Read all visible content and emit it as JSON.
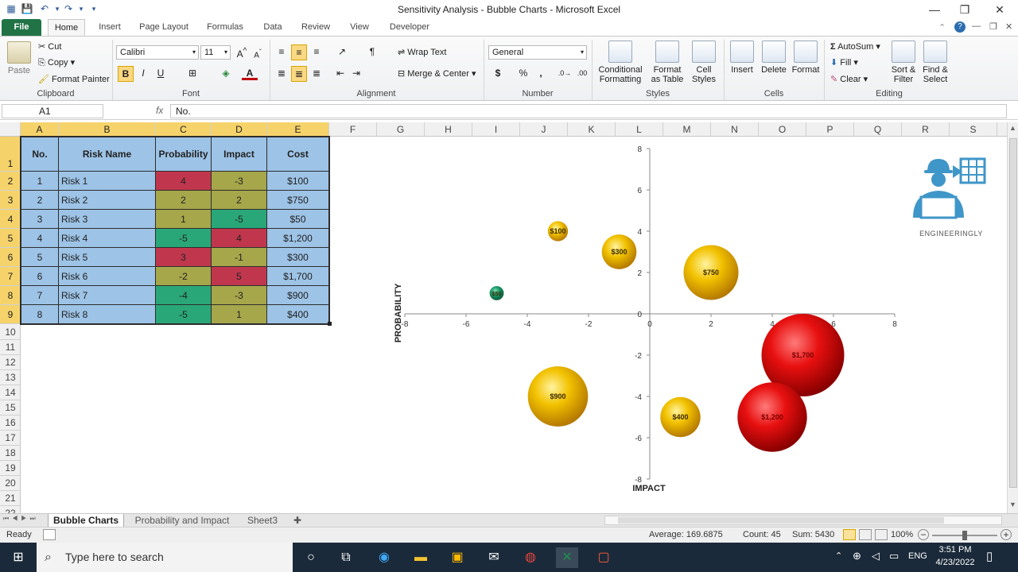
{
  "window": {
    "title": "Sensitivity Analysis - Bubble Charts - Microsoft Excel"
  },
  "ribbon_tabs": [
    "File",
    "Home",
    "Insert",
    "Page Layout",
    "Formulas",
    "Data",
    "Review",
    "View",
    "Developer"
  ],
  "clipboard": {
    "paste": "Paste",
    "cut": "Cut",
    "copy": "Copy",
    "format_painter": "Format Painter",
    "label": "Clipboard"
  },
  "font": {
    "name": "Calibri",
    "size": "11",
    "label": "Font",
    "bold": "B",
    "italic": "I",
    "underline": "U"
  },
  "alignment": {
    "wrap_text": "Wrap Text",
    "merge_center": "Merge & Center",
    "label": "Alignment"
  },
  "number": {
    "format": "General",
    "label": "Number",
    "currency": "$",
    "percent": "%",
    "comma": ","
  },
  "styles": {
    "conditional": "Conditional",
    "formatting": "Formatting",
    "format_as": "Format",
    "as_table": "as Table",
    "cell": "Cell",
    "cell_styles": "Styles",
    "label": "Styles"
  },
  "cells": {
    "insert": "Insert",
    "delete": "Delete",
    "format": "Format",
    "label": "Cells"
  },
  "editing": {
    "autosum": "AutoSum",
    "fill": "Fill",
    "clear": "Clear",
    "sort": "Sort &",
    "filter": "Filter",
    "find": "Find &",
    "select": "Select",
    "label": "Editing"
  },
  "formula_bar": {
    "name_box": "A1",
    "fx": "fx",
    "value": "No."
  },
  "columns": [
    "A",
    "B",
    "C",
    "D",
    "E",
    "F",
    "G",
    "H",
    "I",
    "J",
    "K",
    "L",
    "M",
    "N",
    "O",
    "P",
    "Q",
    "R",
    "S"
  ],
  "rows": [
    "1",
    "2",
    "3",
    "4",
    "5",
    "6",
    "7",
    "8",
    "9",
    "10",
    "11",
    "12",
    "13",
    "14",
    "15",
    "16",
    "17",
    "18",
    "19",
    "20",
    "21",
    "22"
  ],
  "table": {
    "headers": [
      "No.",
      "Risk Name",
      "Probability",
      "Impact",
      "Cost"
    ],
    "rows": [
      {
        "no": "1",
        "name": "Risk 1",
        "prob": "4",
        "impact": "-3",
        "cost": "$100"
      },
      {
        "no": "2",
        "name": "Risk 2",
        "prob": "2",
        "impact": "2",
        "cost": "$750"
      },
      {
        "no": "3",
        "name": "Risk 3",
        "prob": "1",
        "impact": "-5",
        "cost": "$50"
      },
      {
        "no": "4",
        "name": "Risk 4",
        "prob": "-5",
        "impact": "4",
        "cost": "$1,200"
      },
      {
        "no": "5",
        "name": "Risk 5",
        "prob": "3",
        "impact": "-1",
        "cost": "$300"
      },
      {
        "no": "6",
        "name": "Risk 6",
        "prob": "-2",
        "impact": "5",
        "cost": "$1,700"
      },
      {
        "no": "7",
        "name": "Risk 7",
        "prob": "-4",
        "impact": "-3",
        "cost": "$900"
      },
      {
        "no": "8",
        "name": "Risk 8",
        "prob": "-5",
        "impact": "1",
        "cost": "$400"
      }
    ],
    "colors": {
      "red": "#c0374d",
      "olive": "#a6a64b",
      "green": "#2aa779",
      "header": "#9dc3e6"
    }
  },
  "chart_data": {
    "type": "scatter",
    "xlabel": "IMPACT",
    "ylabel": "PROBABILITY",
    "xlim": [
      -8,
      8
    ],
    "ylim": [
      -8,
      8
    ],
    "x_ticks": [
      "-8",
      "-6",
      "-4",
      "-2",
      "0",
      "2",
      "4",
      "6",
      "8"
    ],
    "y_ticks": [
      "8",
      "6",
      "4",
      "2",
      "0",
      "-2",
      "-4",
      "-6",
      "-8"
    ],
    "points": [
      {
        "x": -3,
        "y": 4,
        "size": 100,
        "label": "$100",
        "color": "yellow"
      },
      {
        "x": 2,
        "y": 2,
        "size": 750,
        "label": "$750",
        "color": "yellow"
      },
      {
        "x": -5,
        "y": 1,
        "size": 50,
        "label": "$50",
        "color": "green"
      },
      {
        "x": 4,
        "y": -5,
        "size": 1200,
        "label": "$1,200",
        "color": "red"
      },
      {
        "x": -1,
        "y": 3,
        "size": 300,
        "label": "$300",
        "color": "yellow"
      },
      {
        "x": 5,
        "y": -2,
        "size": 1700,
        "label": "$1,700",
        "color": "red"
      },
      {
        "x": -3,
        "y": -4,
        "size": 900,
        "label": "$900",
        "color": "yellow"
      },
      {
        "x": 1,
        "y": -5,
        "size": 400,
        "label": "$400",
        "color": "yellow"
      }
    ]
  },
  "logo": {
    "text": "ENGINEERINGLY"
  },
  "sheet_tabs": [
    "Bubble Charts",
    "Probability and Impact",
    "Sheet3"
  ],
  "status": {
    "ready": "Ready",
    "average": "Average: 169.6875",
    "count": "Count: 45",
    "sum": "Sum: 5430",
    "zoom": "100%"
  },
  "taskbar": {
    "search": "Type here to search",
    "time": "3:51 PM",
    "date": "4/23/2022",
    "lang": "ENG"
  }
}
